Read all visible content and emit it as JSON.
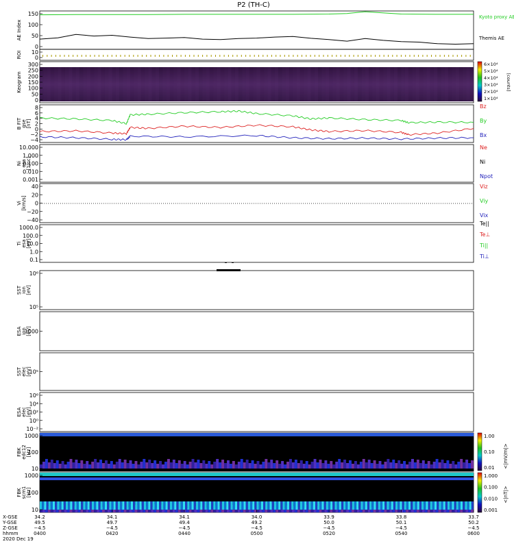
{
  "title": "P2 (TH-C)",
  "date_label": "2020 Dec 19",
  "colors": {
    "ae_kyoto": "#22cc22",
    "ae_themis": "#000000",
    "bz": "#dd2222",
    "by": "#22cc22",
    "bx": "#2222bb",
    "fbk_bg": "#000000",
    "keogram_bg": "#3a1a4a"
  },
  "chart_data": [
    {
      "type": "line",
      "panel": "ae",
      "ylabel": "AE Index",
      "ylim": [
        0,
        150
      ],
      "yticks": [
        "150",
        "100",
        "50",
        "0"
      ],
      "series": [
        {
          "name": "Kyoto proxy AE",
          "x": [
            0,
            10,
            20,
            30,
            40,
            50,
            60,
            70,
            80,
            85,
            90,
            100,
            110,
            120
          ],
          "values": [
            135,
            136,
            136,
            136,
            137,
            137,
            137,
            137,
            138,
            140,
            147,
            138,
            137,
            137
          ]
        },
        {
          "name": "Themis AE",
          "x": [
            0,
            5,
            10,
            15,
            20,
            25,
            30,
            35,
            40,
            45,
            50,
            55,
            60,
            65,
            70,
            75,
            80,
            85,
            90,
            95,
            100,
            105,
            110,
            115,
            120
          ],
          "values": [
            40,
            45,
            58,
            52,
            55,
            48,
            42,
            44,
            46,
            40,
            38,
            42,
            44,
            48,
            50,
            43,
            38,
            32,
            42,
            35,
            30,
            28,
            22,
            20,
            22
          ]
        }
      ]
    },
    {
      "type": "line",
      "panel": "roi",
      "ylabel": "ROI",
      "yticks": [
        "10",
        "0"
      ]
    },
    {
      "type": "heatmap",
      "panel": "keogram",
      "ylabel": "Keogram",
      "ylim": [
        0,
        300
      ],
      "yticks": [
        "300",
        "250",
        "200",
        "150",
        "100",
        "50",
        "0"
      ],
      "colorbar": {
        "label": "[counts]",
        "ticks": [
          "6×10⁴",
          "5×10⁴",
          "4×10⁴",
          "3×10⁴",
          "2×10⁴",
          "1×10⁴"
        ]
      }
    },
    {
      "type": "line",
      "panel": "bfield",
      "ylabel": "B FIT",
      "ylabel2": "gse",
      "ylabel3": "[nT]",
      "ylim": [
        -4,
        8
      ],
      "yticks": [
        "8",
        "6",
        "4",
        "2",
        "0",
        "−2",
        "−4"
      ],
      "series": [
        {
          "name": "Bz",
          "x": [
            0,
            10,
            20,
            24,
            25,
            30,
            40,
            50,
            60,
            70,
            75,
            80,
            90,
            100,
            102,
            110,
            120
          ],
          "values": [
            -0.5,
            -0.3,
            -1.0,
            -1.2,
            0.8,
            0.5,
            1.2,
            0.8,
            1.5,
            1.0,
            0.0,
            -0.5,
            -0.2,
            -0.8,
            -1.5,
            -1.0,
            0.5
          ]
        },
        {
          "name": "By",
          "x": [
            0,
            10,
            20,
            24,
            25,
            30,
            40,
            50,
            55,
            60,
            70,
            75,
            80,
            90,
            100,
            102,
            110,
            120
          ],
          "values": [
            3.8,
            3.5,
            3.0,
            2.0,
            4.8,
            5.0,
            5.5,
            5.8,
            6.0,
            5.2,
            4.5,
            3.5,
            3.8,
            3.3,
            3.0,
            2.3,
            2.5,
            2.4
          ]
        },
        {
          "name": "Bx",
          "x": [
            0,
            10,
            20,
            24,
            25,
            40,
            60,
            70,
            80,
            90,
            100,
            110,
            120
          ],
          "values": [
            -2.2,
            -2.5,
            -3.0,
            -3.1,
            -2.0,
            -2.2,
            -1.8,
            -2.5,
            -2.8,
            -2.6,
            -2.9,
            -2.6,
            -2.5
          ]
        }
      ]
    },
    {
      "type": "line",
      "panel": "density",
      "ylabel": "Ni",
      "ylabel2": "esa",
      "ylabel3": "[1/cc]",
      "yscale": "log",
      "yticks": [
        "10.000",
        "1.000",
        "0.100",
        "0.010",
        "0.001"
      ],
      "legend": [
        "Ne",
        "Ni",
        "Npot"
      ]
    },
    {
      "type": "line",
      "panel": "velocity",
      "ylabel": "Vi",
      "ylabel2": "[km/s]",
      "ylim": [
        -50,
        50
      ],
      "yticks": [
        "40",
        "20",
        "0",
        "−20",
        "−40"
      ],
      "legend": [
        "Viz",
        "Viy",
        "Vix"
      ]
    },
    {
      "type": "line",
      "panel": "temperature",
      "ylabel": "Ti",
      "ylabel2": "esa",
      "ylabel3": "[eV]",
      "yscale": "log",
      "yticks": [
        "1000.0",
        "100.0",
        "10.0",
        "1.0",
        "0.1"
      ],
      "legend": [
        "Te||",
        "Te⊥",
        "Ti||",
        "Ti⊥"
      ]
    },
    {
      "type": "heatmap",
      "panel": "sst_ion",
      "ylabel": "SST",
      "ylabel2": "ion",
      "ylabel3": "[eV]",
      "yticks": [
        "10⁶",
        "10⁵"
      ]
    },
    {
      "type": "heatmap",
      "panel": "esa_ion",
      "ylabel": "ESA",
      "ylabel2": "ion",
      "ylabel3": "[eV]",
      "yticks": [
        "1000"
      ]
    },
    {
      "type": "heatmap",
      "panel": "sst_elec",
      "ylabel": "SST",
      "ylabel2": "elec",
      "ylabel3": "[eV]",
      "yticks": [
        "10⁵"
      ]
    },
    {
      "type": "heatmap",
      "panel": "esa_elec",
      "ylabel": "ESA",
      "ylabel2": "elec",
      "ylabel3": "[eV]",
      "yticks": [
        "10⁶",
        "10⁴",
        "10²",
        "10⁰",
        "10⁻²"
      ]
    },
    {
      "type": "heatmap",
      "panel": "fbk_edc",
      "ylabel": "FBK",
      "ylabel2": "edc12",
      "ylabel3": "[Hz]",
      "yticks": [
        "1000",
        "100",
        "10"
      ],
      "colorbar": {
        "label": "<|mV/m|>",
        "ticks": [
          "1.00",
          "0.10",
          "0.01"
        ]
      }
    },
    {
      "type": "heatmap",
      "panel": "fbk_scm",
      "ylabel": "FBK",
      "ylabel2": "scm1",
      "ylabel3": "[Hz]",
      "yticks": [
        "1000",
        "100",
        "10"
      ],
      "colorbar": {
        "label": "<|nT|>",
        "ticks": [
          "1.000",
          "0.100",
          "0.010",
          "0.001"
        ]
      }
    }
  ],
  "time_axis": {
    "row_labels": [
      "X-GSE",
      "Y-GSE",
      "Z-GSE",
      "hhmm",
      "2020 Dec 19"
    ],
    "columns": [
      {
        "x": [
          "34.2",
          "49.5",
          "−4.5",
          "0400"
        ]
      },
      {
        "x": [
          "34.1",
          "49.7",
          "−4.5",
          "0420"
        ]
      },
      {
        "x": [
          "34.1",
          "49.4",
          "−4.5",
          "0440"
        ]
      },
      {
        "x": [
          "34.0",
          "49.2",
          "−4.5",
          "0500"
        ]
      },
      {
        "x": [
          "33.9",
          "50.0",
          "−4.5",
          "0520"
        ]
      },
      {
        "x": [
          "33.8",
          "50.1",
          "−4.5",
          "0540"
        ]
      },
      {
        "x": [
          "33.7",
          "50.2",
          "−4.5",
          "0600"
        ]
      }
    ]
  }
}
